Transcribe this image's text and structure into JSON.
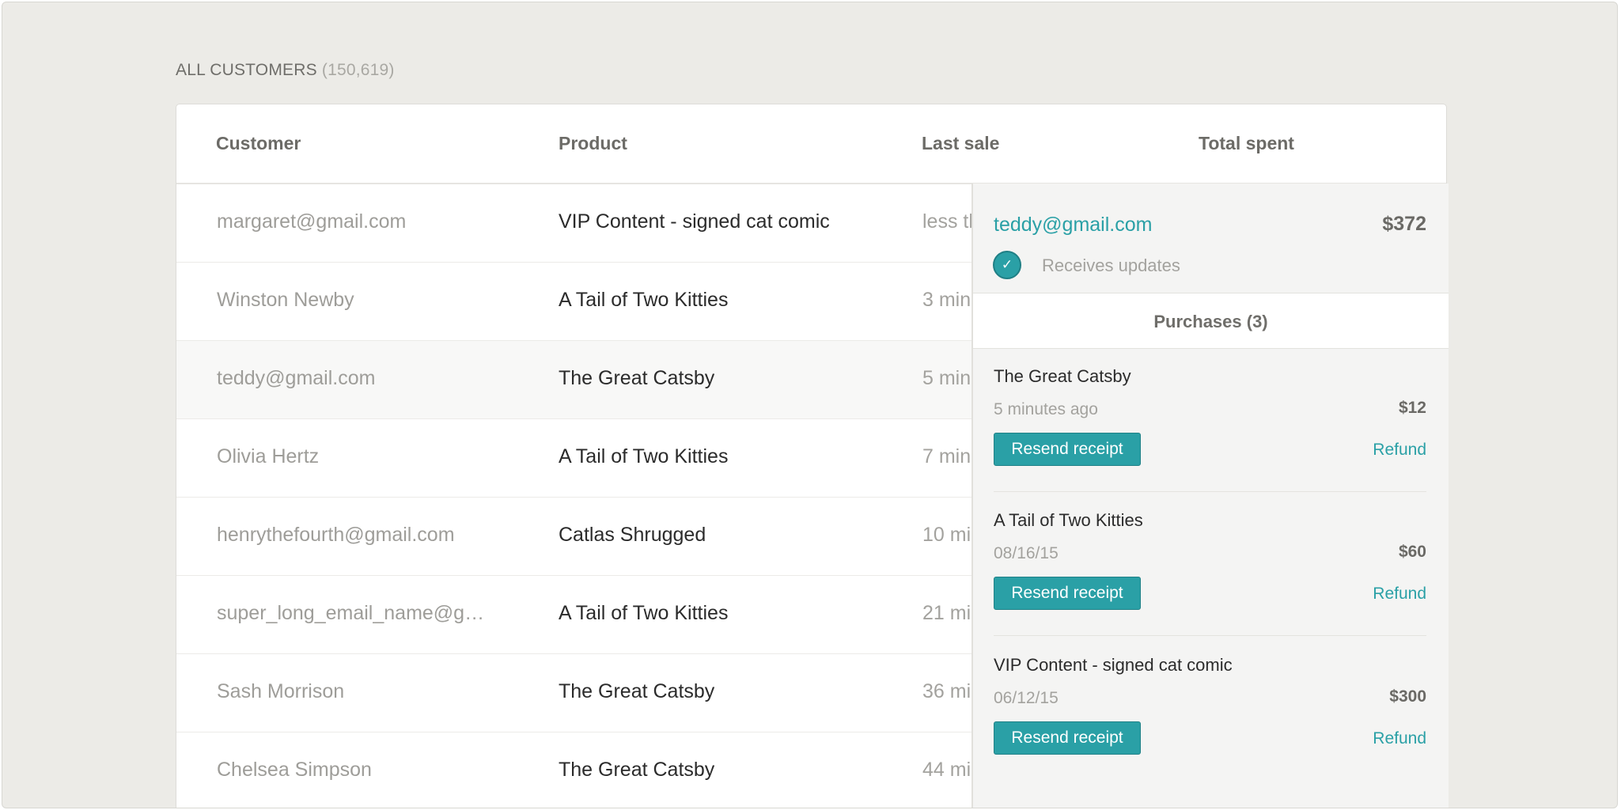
{
  "heading": {
    "title": "ALL CUSTOMERS",
    "count": "(150,619)"
  },
  "table": {
    "headers": {
      "customer": "Customer",
      "product": "Product",
      "last_sale": "Last sale",
      "total_spent": "Total spent"
    },
    "rows": [
      {
        "customer": "margaret@gmail.com",
        "product": "VIP Content - signed cat comic",
        "last_sale": "less th"
      },
      {
        "customer": "Winston Newby",
        "product": "A Tail of Two Kitties",
        "last_sale": "3 min"
      },
      {
        "customer": "teddy@gmail.com",
        "product": "The Great Catsby",
        "last_sale": "5 min"
      },
      {
        "customer": "Olivia Hertz",
        "product": "A Tail of Two Kitties",
        "last_sale": "7 min"
      },
      {
        "customer": "henrythefourth@gmail.com",
        "product": "Catlas Shrugged",
        "last_sale": "10 mi"
      },
      {
        "customer": "super_long_email_name@g…",
        "product": "A Tail of Two Kitties",
        "last_sale": "21 mi"
      },
      {
        "customer": "Sash Morrison",
        "product": "The Great Catsby",
        "last_sale": "36 mi"
      },
      {
        "customer": "Chelsea Simpson",
        "product": "The Great Catsby",
        "last_sale": "44 mi"
      }
    ]
  },
  "panel": {
    "email": "teddy@gmail.com",
    "total": "$372",
    "updates_label": "Receives updates",
    "purchases_tab": "Purchases (3)",
    "purchases": [
      {
        "name": "The Great Catsby",
        "date": "5 minutes ago",
        "amount": "$12",
        "resend": "Resend receipt",
        "refund": "Refund"
      },
      {
        "name": "A Tail of Two Kitties",
        "date": "08/16/15",
        "amount": "$60",
        "resend": "Resend receipt",
        "refund": "Refund"
      },
      {
        "name": "VIP Content - signed cat comic",
        "date": "06/12/15",
        "amount": "$300",
        "resend": "Resend receipt",
        "refund": "Refund"
      }
    ]
  },
  "colors": {
    "accent": "#2aa0a6",
    "background": "#ecebe7"
  },
  "icons": {
    "updates": "checkmark-icon"
  }
}
